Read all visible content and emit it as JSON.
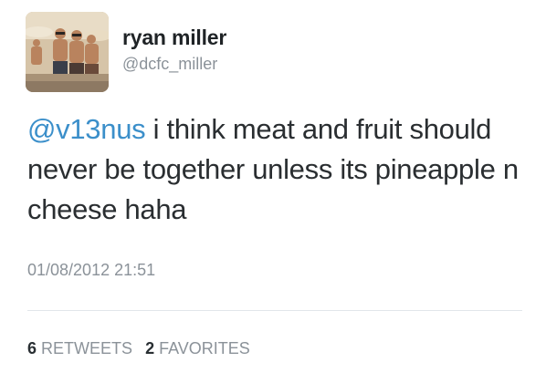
{
  "user": {
    "display_name": "ryan miller",
    "handle": "@dcfc_miller"
  },
  "tweet": {
    "mention": "@v13nus",
    "text": " i think meat and fruit should never be together unless its pineapple n cheese haha",
    "timestamp": "01/08/2012 21:51"
  },
  "stats": {
    "retweets_count": "6",
    "retweets_label": "RETWEETS",
    "favorites_count": "2",
    "favorites_label": "FAVORITES"
  },
  "colors": {
    "link": "#3b8fca",
    "muted": "#8b9299",
    "text": "#2a2e31"
  }
}
